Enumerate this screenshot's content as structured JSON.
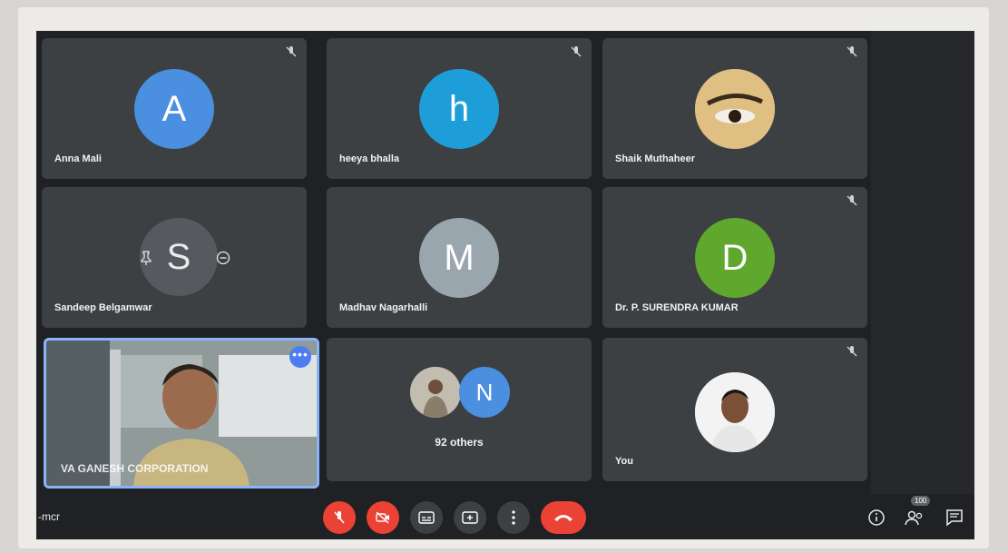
{
  "participants": [
    {
      "name": "Anna Mali",
      "initial": "A",
      "color": "#4a8fe0"
    },
    {
      "name": "heeya bhalla",
      "initial": "h",
      "color": "#1e9ed8"
    },
    {
      "name": "Shaik Muthaheer",
      "initial": "",
      "color": "#d8b978"
    },
    {
      "name": "Sandeep Belgamwar",
      "initial": "S",
      "color": "#5a5e62"
    },
    {
      "name": "Madhav Nagarhalli",
      "initial": "M",
      "color": "#9aa6ad"
    },
    {
      "name": "Dr. P. SURENDRA KUMAR",
      "initial": "D",
      "color": "#5fa82d"
    }
  ],
  "presenter": {
    "caption": "VA GANESH CORPORATION",
    "more_label": "•••"
  },
  "others": {
    "avatar_initial": "N",
    "avatar_color": "#4a8fe0",
    "label": "92 others"
  },
  "self": {
    "name": "You"
  },
  "meeting_code": "-mcr",
  "controls": {
    "mic": "mic-off",
    "camera": "camera-off",
    "captions": "captions",
    "present": "present-now",
    "more": "more-options",
    "hangup": "leave-call"
  },
  "participant_count": "100",
  "colors": {
    "danger": "#ea4335",
    "accent": "#8ab4f8",
    "tile": "#3c4043"
  }
}
